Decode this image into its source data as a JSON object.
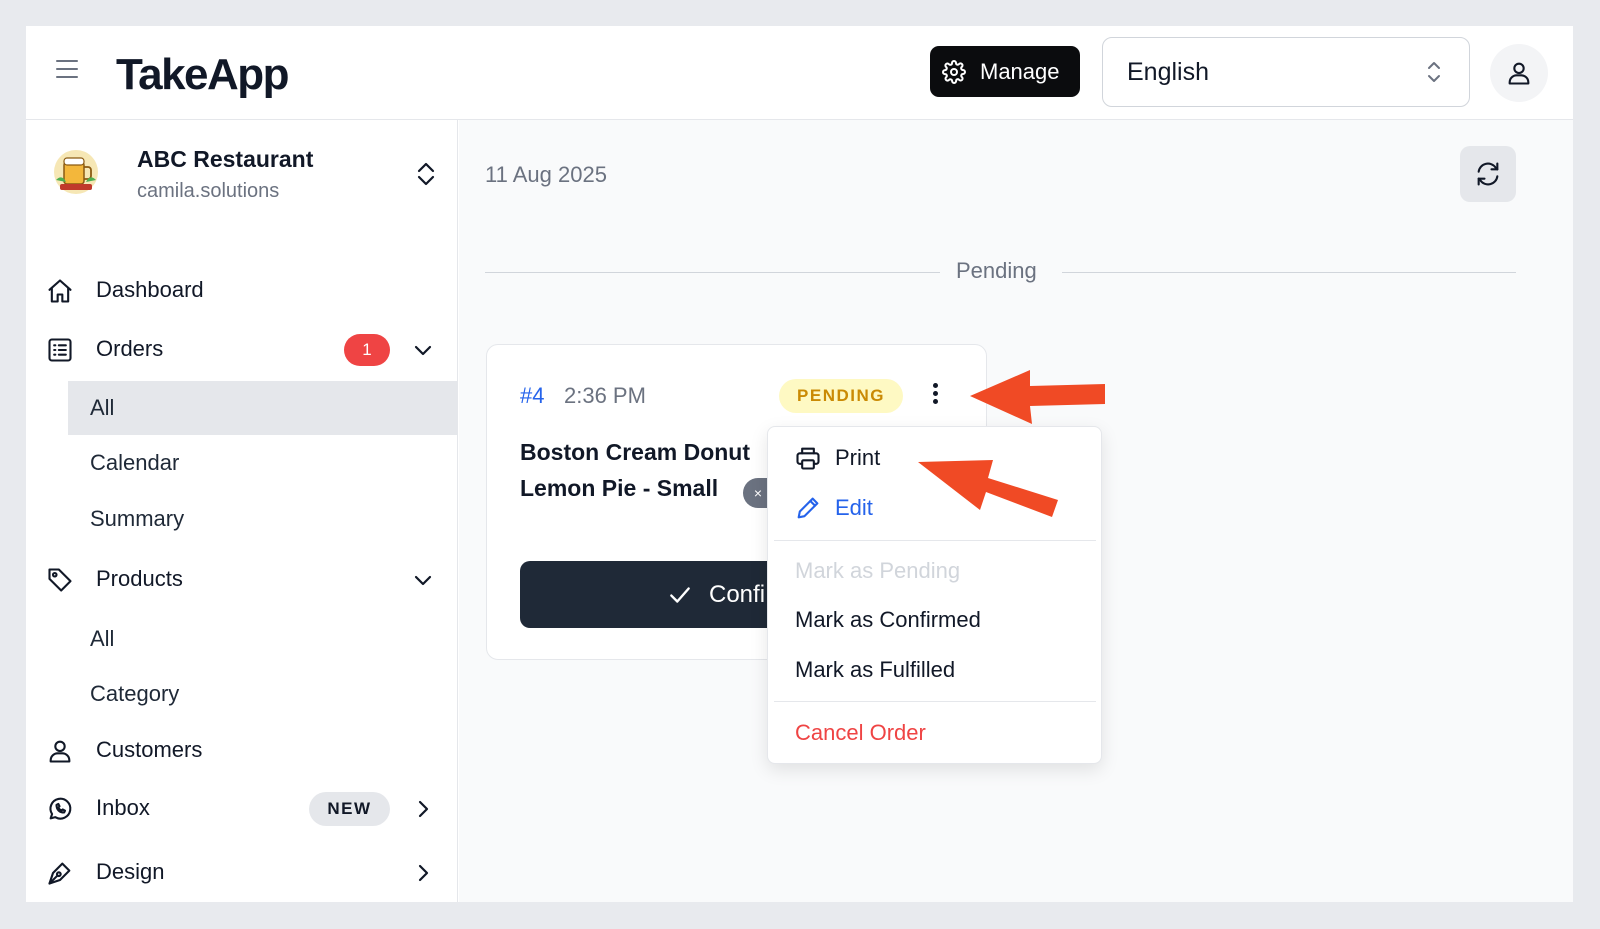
{
  "app": {
    "logo": "TakeApp",
    "manage_label": "Manage",
    "language_value": "English"
  },
  "store": {
    "name": "ABC Restaurant",
    "domain": "camila.solutions"
  },
  "sidebar": {
    "dashboard": "Dashboard",
    "orders": "Orders",
    "orders_badge": "1",
    "orders_sub": [
      "All",
      "Calendar",
      "Summary"
    ],
    "products": "Products",
    "products_sub": [
      "All",
      "Category"
    ],
    "customers": "Customers",
    "inbox": "Inbox",
    "inbox_badge": "NEW",
    "design": "Design"
  },
  "main": {
    "date": "11 Aug 2025",
    "section_label": "Pending"
  },
  "order": {
    "number": "#4",
    "time": "2:36 PM",
    "status": "PENDING",
    "items": [
      "Boston Cream Donut",
      "Lemon Pie - Small"
    ],
    "qty_chip": "×",
    "confirm_label": "Confi"
  },
  "menu": {
    "print": "Print",
    "edit": "Edit",
    "mark_pending": "Mark as Pending",
    "mark_confirmed": "Mark as Confirmed",
    "mark_fulfilled": "Mark as Fulfilled",
    "cancel": "Cancel Order"
  },
  "colors": {
    "accent_blue": "#2563eb",
    "badge_red": "#ef4444",
    "pending_text": "#ca8a04",
    "pending_bg": "#fef9c3",
    "cancel_red": "#ef4444",
    "annotation_arrow": "#f04a25"
  },
  "icons": {
    "menu": "hamburger-icon",
    "manage": "gear-icon",
    "language": "chevron-up-down-icon",
    "account": "user-icon",
    "refresh": "refresh-icon",
    "dashboard": "home-icon",
    "orders": "list-icon",
    "products": "tag-icon",
    "customers": "user-icon",
    "inbox": "whatsapp-icon",
    "design": "pen-icon",
    "print": "printer-icon",
    "edit": "pencil-icon",
    "confirm": "check-icon"
  }
}
